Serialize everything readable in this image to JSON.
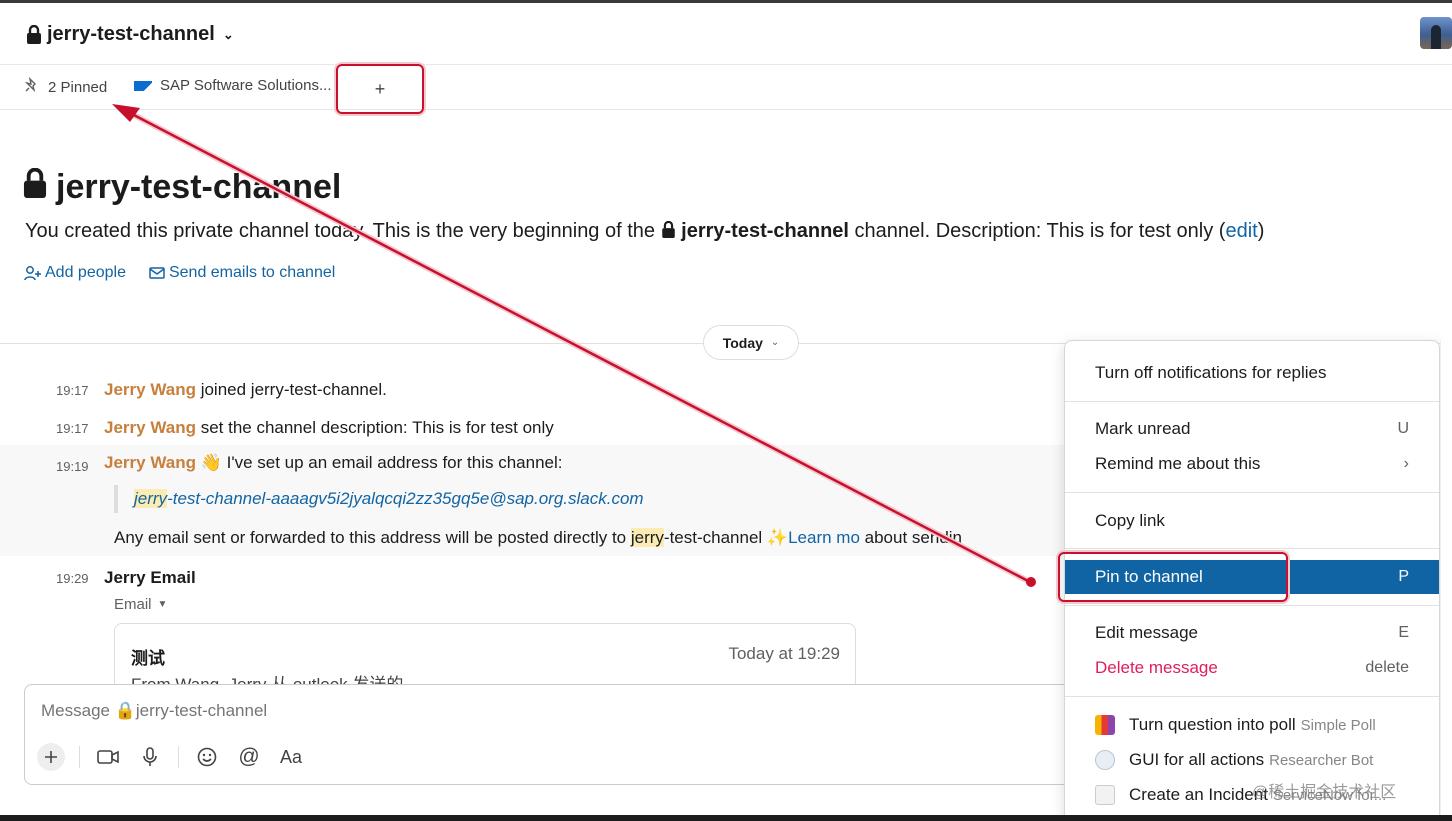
{
  "header": {
    "channel_name": "jerry-test-channel"
  },
  "bookmarks": {
    "pinned_label": "2 Pinned",
    "sap_label": "SAP Software Solutions...",
    "add_label": "+"
  },
  "intro": {
    "title": "jerry-test-channel",
    "text_before": "You created this private channel today. This is the very beginning of the ",
    "channel_name": "jerry-test-channel",
    "text_after": " channel. Description: This is for test only (",
    "edit_label": "edit",
    "text_close": ")",
    "add_people": "Add people",
    "send_emails": "Send emails to channel"
  },
  "divider": {
    "label": "Today"
  },
  "messages": [
    {
      "time": "19:17",
      "author": "Jerry Wang",
      "text": " joined jerry-test-channel."
    },
    {
      "time": "19:17",
      "author": "Jerry Wang",
      "text": " set the channel description: This is for test only"
    },
    {
      "time": "19:19",
      "author": "Jerry Wang",
      "emoji": "👋",
      "text": " I've set up an email address for this channel:",
      "email_mark": "jerry",
      "email_rest": "-test-channel-aaaagv5i2jyalqcqi2zz35gq5e@sap.org.slack.com",
      "info_before": "Any email sent or forwarded to this address will be posted directly to ",
      "info_mark": "jerry",
      "info_rest": "-test-channel ",
      "info_sparkle": "✨",
      "info_link": "Learn mo",
      "info_tail": "  about sendin"
    },
    {
      "time": "19:29",
      "author": "Jerry Email",
      "meta": "Email",
      "card": {
        "subject": "测试",
        "date": "Today at 19:29",
        "from": "From Wang, Jerry  从 outlook 发送的"
      }
    }
  ],
  "composer": {
    "placeholder": "Message 🔒jerry-test-channel",
    "format_label": "Aa"
  },
  "menu": {
    "turn_off": "Turn off notifications for replies",
    "mark_unread": "Mark unread",
    "mark_unread_key": "U",
    "remind": "Remind me about this",
    "remind_key": "›",
    "copy_link": "Copy link",
    "pin": "Pin to channel",
    "pin_key": "P",
    "edit": "Edit message",
    "edit_key": "E",
    "delete": "Delete message",
    "delete_key": "delete",
    "apps": [
      {
        "label": "Turn question into poll",
        "app": "Simple Poll"
      },
      {
        "label": "GUI for all actions",
        "app": "Researcher Bot"
      },
      {
        "label": "Create an Incident",
        "app": "ServiceNow for..."
      }
    ]
  },
  "watermark": "@稀土掘金技术社区",
  "colors": {
    "link": "#1264a3",
    "author": "#c87f3c",
    "menu_active": "#1164a3",
    "danger": "#e01e5a",
    "annotation": "#c8102e"
  }
}
